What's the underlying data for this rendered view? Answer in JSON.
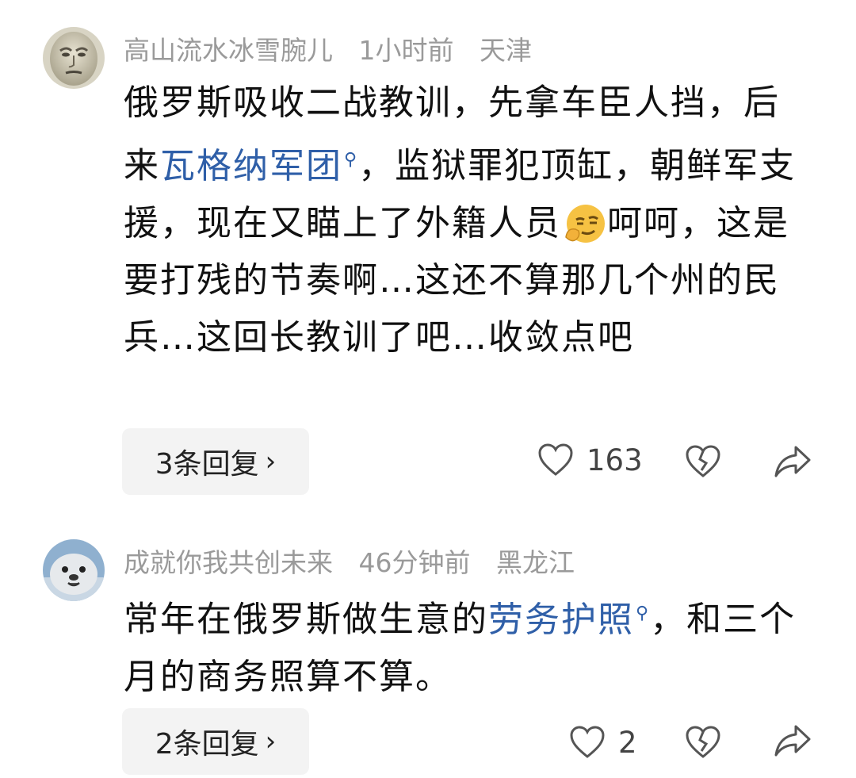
{
  "comments": [
    {
      "username": "高山流水冰雪腕儿",
      "time": "1小时前",
      "location": "天津",
      "text_parts": {
        "p1": "俄罗斯吸收二战教训，先拿车臣人挡，",
        "p2": "后来",
        "link": "瓦格纳军团",
        "p3": "，监狱罪犯顶缸，朝鲜军支援，现在又瞄上了外籍人员",
        "p4": "呵呵，这是要打残的节奏啊…这还不算那几个州的民兵…这回长教训了吧…收敛点吧"
      },
      "replies_label": "3条回复",
      "likes": "163",
      "avatar_icon": "stone-face-avatar",
      "emoji_icon": "smirk-thinking-emoji"
    },
    {
      "username": "成就你我共创未来",
      "time": "46分钟前",
      "location": "黑龙江",
      "text_parts": {
        "p1": "常年在俄罗斯做生意的",
        "link": "劳务护照",
        "p2": "，和三个月的商务照算不算。"
      },
      "replies_label": "2条回复",
      "likes": "2",
      "avatar_icon": "seal-avatar"
    }
  ],
  "icons": {
    "like": "heart-outline-icon",
    "dislike": "broken-heart-icon",
    "share": "share-arrow-icon",
    "search": "search-icon",
    "chevron": "chevron-right-icon"
  },
  "colors": {
    "link": "#2f5fa8",
    "meta": "#9a9a9a",
    "reply_bg": "#f3f3f3"
  }
}
